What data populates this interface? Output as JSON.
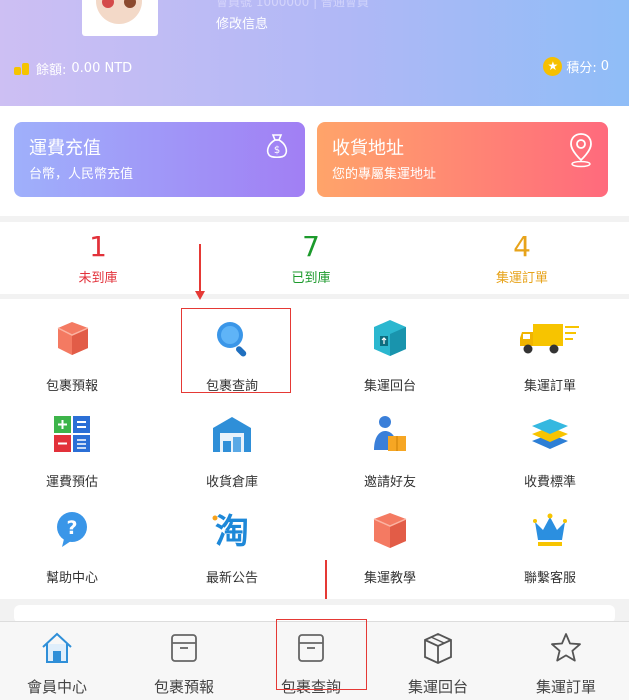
{
  "header": {
    "member_line": "會員號 1000000 | 普通會員",
    "edit_info": "修改信息",
    "balance_label": "餘額:",
    "balance_value": "0.00 NTD",
    "points_label": "積分:",
    "points_value": "0"
  },
  "cards": {
    "recharge": {
      "title": "運費充值",
      "subtitle": "台幣，人民幣充值"
    },
    "address": {
      "title": "收貨地址",
      "subtitle": "您的專屬集運地址"
    }
  },
  "stats": [
    {
      "value": "1",
      "label": "未到庫"
    },
    {
      "value": "7",
      "label": "已到庫"
    },
    {
      "value": "4",
      "label": "集運訂單"
    }
  ],
  "menu": [
    {
      "label": "包裹預報"
    },
    {
      "label": "包裹查詢"
    },
    {
      "label": "集運回台"
    },
    {
      "label": "集運訂單"
    },
    {
      "label": "運費預估"
    },
    {
      "label": "收貨倉庫"
    },
    {
      "label": "邀請好友"
    },
    {
      "label": "收費標準"
    },
    {
      "label": "幫助中心"
    },
    {
      "label": "最新公告"
    },
    {
      "label": "集運教學"
    },
    {
      "label": "聯繫客服"
    }
  ],
  "tabbar": [
    {
      "label": "會員中心"
    },
    {
      "label": "包裹預報"
    },
    {
      "label": "包裹查詢"
    },
    {
      "label": "集運回台"
    },
    {
      "label": "集運訂單"
    }
  ],
  "colors": {
    "pending": "#e2313a",
    "arrived": "#1c9a2c",
    "orders": "#e7a31a",
    "annotation": "#e53935"
  }
}
